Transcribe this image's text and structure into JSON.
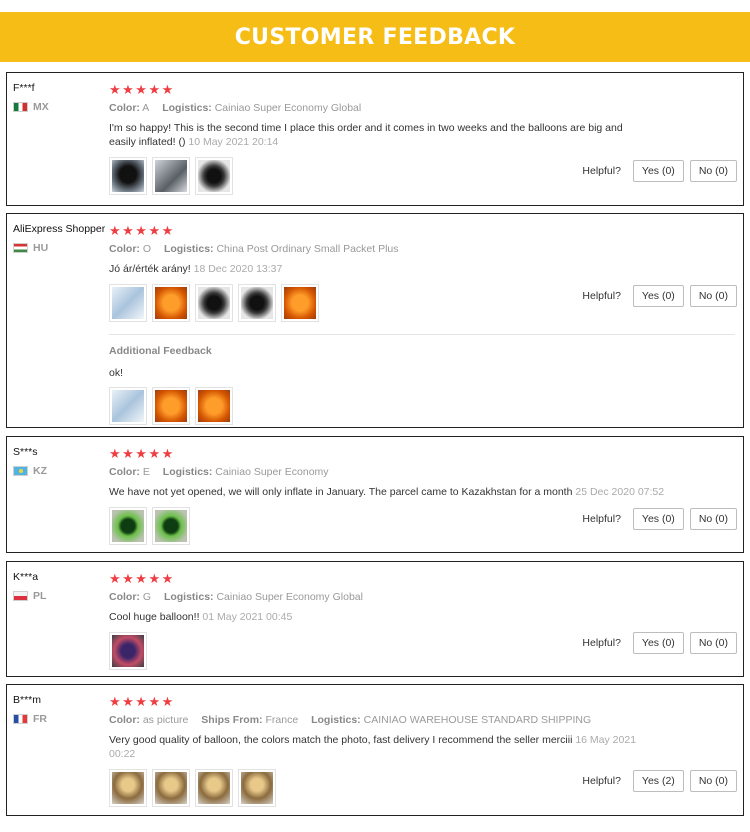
{
  "banner": {
    "title": "CUSTOMER FEEDBACK"
  },
  "labels": {
    "color": "Color:",
    "logistics": "Logistics:",
    "ships_from": "Ships From:",
    "helpful": "Helpful?",
    "additional_feedback": "Additional Feedback"
  },
  "colors": {
    "banner": "#f5bd16",
    "stars": "#ef3e43"
  },
  "reviews": [
    {
      "reviewer": "F***f",
      "country": "MX",
      "stars": "★★★★★",
      "rating": 5,
      "color": "A",
      "logistics": "Cainiao Super Economy Global",
      "text": "I'm so happy! This is the second time I place this order and it comes in two weeks and the balloons are big and easily inflated! ()",
      "date": "10 May 2021 20:14",
      "photos": 3,
      "yes": "Yes (0)",
      "no": "No (0)"
    },
    {
      "reviewer": "AliExpress Shopper",
      "country": "HU",
      "stars": "★★★★★",
      "rating": 5,
      "color": "O",
      "logistics": "China Post Ordinary Small Packet Plus",
      "text": "Jó ár/érték arány!",
      "date": "18 Dec 2020 13:37",
      "photos": 5,
      "additional_text": "ok!",
      "additional_photos": 3,
      "yes": "Yes (0)",
      "no": "No (0)"
    },
    {
      "reviewer": "S***s",
      "country": "KZ",
      "stars": "★★★★★",
      "rating": 5,
      "color": "E",
      "logistics": "Cainiao Super Economy",
      "text": "We have not yet opened, we will only inflate in January. The parcel came to Kazakhstan for a month",
      "date": "25 Dec 2020 07:52",
      "photos": 2,
      "yes": "Yes (0)",
      "no": "No (0)"
    },
    {
      "reviewer": "K***a",
      "country": "PL",
      "stars": "★★★★★",
      "rating": 5,
      "color": "G",
      "logistics": "Cainiao Super Economy Global",
      "text": "Cool huge balloon!!",
      "date": "01 May 2021 00:45",
      "photos": 1,
      "yes": "Yes (0)",
      "no": "No (0)"
    },
    {
      "reviewer": "B***m",
      "country": "FR",
      "stars": "★★★★★",
      "rating": 5,
      "color": "as picture",
      "ships_from": "France",
      "logistics": "CAINIAO WAREHOUSE STANDARD SHIPPING",
      "text": "Very good quality of balloon, the colors match the photo, fast delivery I recommend the seller merciii",
      "date": "16 May 2021 00:22",
      "photos": 4,
      "yes": "Yes (2)",
      "no": "No (0)"
    }
  ]
}
